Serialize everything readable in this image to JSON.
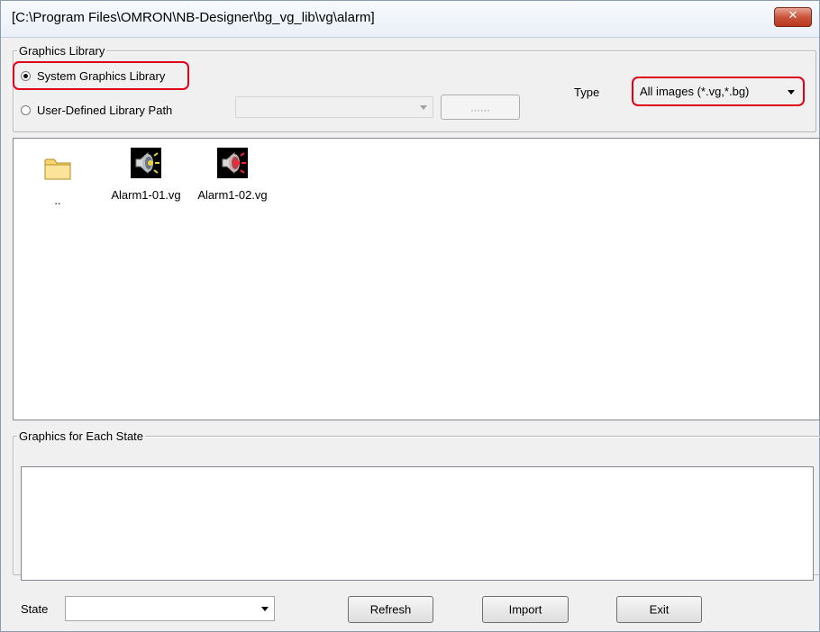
{
  "window": {
    "title": "[C:\\Program Files\\OMRON\\NB-Designer\\bg_vg_lib\\vg\\alarm]"
  },
  "library_group": {
    "legend": "Graphics Library",
    "system_option": "System Graphics Library",
    "user_option": "User-Defined Library Path",
    "browse_label": "......",
    "selected": "system"
  },
  "type": {
    "label": "Type",
    "value": "All images (*.vg,*.bg)"
  },
  "files": [
    {
      "name": "..",
      "icon": "folder-icon"
    },
    {
      "name": "Alarm1-01.vg",
      "icon": "alarm-speaker-icon"
    },
    {
      "name": "Alarm1-02.vg",
      "icon": "alarm-speaker-red-icon"
    }
  ],
  "state_group": {
    "legend": "Graphics for Each State"
  },
  "bottom": {
    "state_label": "State",
    "state_value": "",
    "refresh": "Refresh",
    "import": "Import",
    "exit": "Exit"
  },
  "colors": {
    "highlight": "#e00018",
    "close_button": "#c9543b"
  }
}
